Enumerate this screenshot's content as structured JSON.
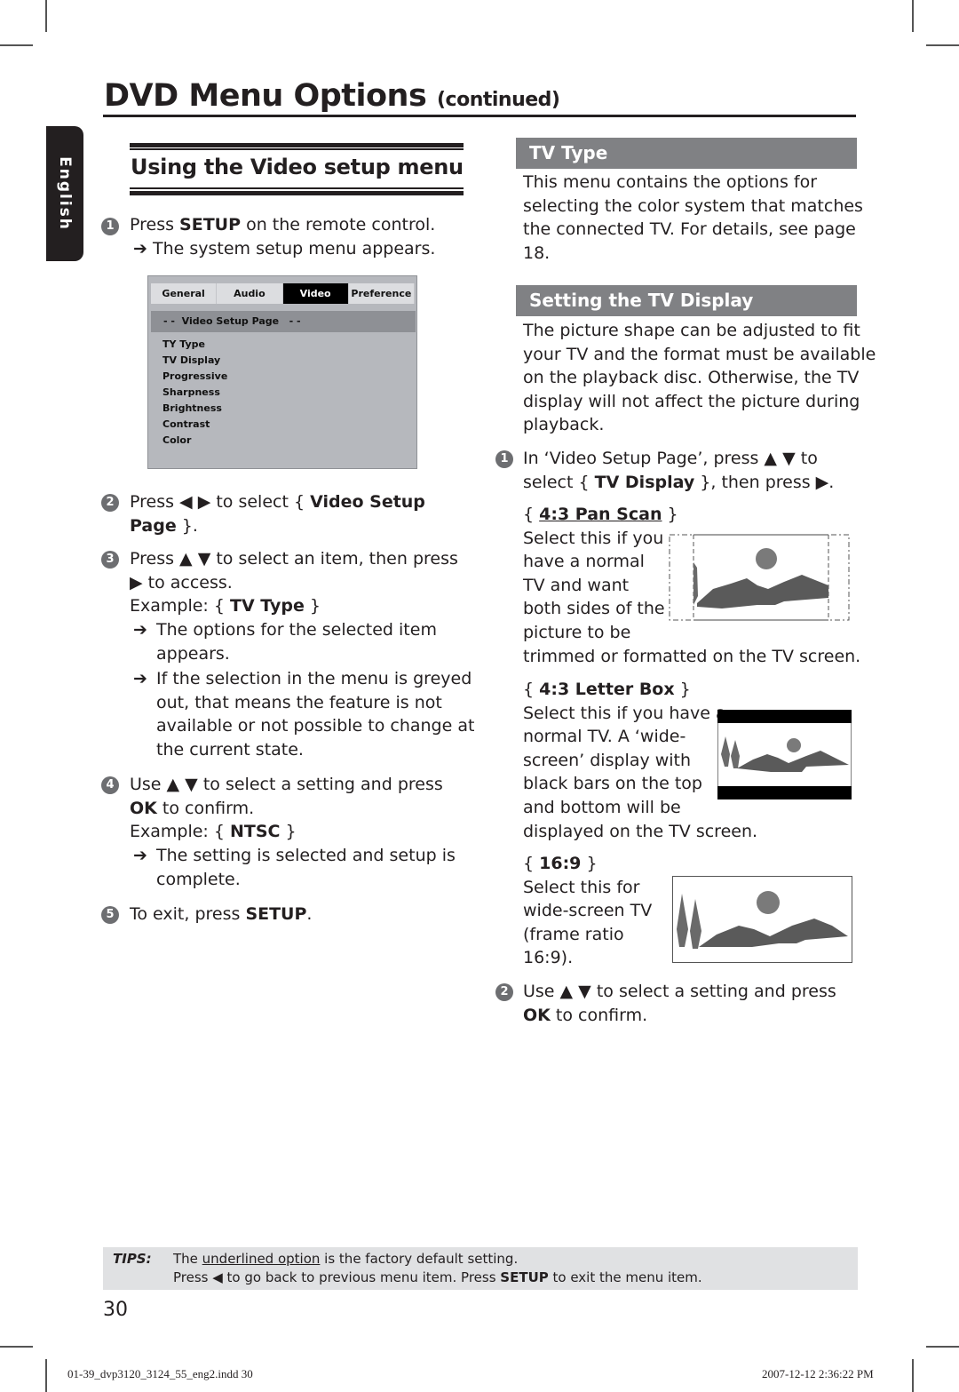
{
  "header": {
    "title": "DVD Menu Options",
    "title_suffix": "(continued)"
  },
  "language_tab": "English",
  "left": {
    "section_title": "Using the Video setup menu",
    "step1": {
      "number": "1",
      "pre": "Press ",
      "bold": "SETUP",
      "post": " on the remote control.",
      "result": "The system setup menu appears."
    },
    "setup_menu": {
      "tabs": [
        {
          "label": "General",
          "active": false
        },
        {
          "label": "Audio",
          "active": false
        },
        {
          "label": "Video",
          "active": true
        },
        {
          "label": "Preference",
          "active": false
        }
      ],
      "page_header": "- -  Video Setup Page   - -",
      "items": [
        "TY Type",
        "TV Display",
        "Progressive",
        "Sharpness",
        "Brightness",
        "Contrast",
        "Color"
      ]
    },
    "step2": {
      "number": "2",
      "pre": "Press ◀ ▶ to select { ",
      "bold1": "Video Setup",
      "bold2": "Page",
      "post": " }."
    },
    "step3": {
      "number": "3",
      "line1": "Press ▲ ▼ to select an item, then press",
      "line2": "▶ to access.",
      "example_pre": "Example: { ",
      "example_bold": "TV Type",
      "example_post": " }",
      "result1": [
        "The options for the selected item",
        "appears."
      ],
      "result2": [
        "If the selection in the menu is greyed",
        "out, that means the feature is not",
        "available or not possible to change at",
        "the current state."
      ]
    },
    "step4": {
      "number": "4",
      "line1": "Use ▲ ▼ to select a setting and press",
      "ok_bold": "OK",
      "ok_post": " to confirm.",
      "example_pre": "Example: { ",
      "example_bold": "NTSC",
      "example_post": " }",
      "result": [
        "The setting is selected and setup is",
        "complete."
      ]
    },
    "step5": {
      "number": "5",
      "pre": "To exit, press ",
      "bold": "SETUP",
      "post": "."
    }
  },
  "right": {
    "tv_type": {
      "heading": "TV Type",
      "body": [
        "This menu contains the options for",
        "selecting the color system that matches",
        "the connected TV. For details, see page",
        "18."
      ]
    },
    "tv_display": {
      "heading": "Setting the TV Display",
      "body": [
        "The picture shape can be adjusted to fit",
        "your TV and the format must be available",
        "on the playback disc. Otherwise, the TV",
        "display will not affect the picture during",
        "playback."
      ],
      "step1": {
        "number": "1",
        "line1": "In ‘Video Setup Page’, press ▲ ▼ to",
        "line2_pre": "select { ",
        "line2_bold": "TV Display",
        "line2_post": " }, then press ▶."
      },
      "options": [
        {
          "name": "4:3 Pan Scan",
          "default": true,
          "lines": [
            "Select this if you",
            "have a normal",
            "TV and want",
            "both sides of the",
            "picture to be",
            "trimmed or formatted on the TV screen."
          ],
          "illustration": "pan-scan"
        },
        {
          "name": "4:3 Letter Box",
          "default": false,
          "lines": [
            "Select this if you have a",
            "normal TV. A  ‘wide-",
            "screen’ display with",
            "black bars on the top",
            "and bottom will be",
            "displayed on the TV screen."
          ],
          "illustration": "letter-box"
        },
        {
          "name": "16:9",
          "default": false,
          "lines": [
            "Select this for",
            "wide-screen TV",
            "(frame ratio",
            "16:9)."
          ],
          "illustration": "wide-screen"
        }
      ],
      "step2": {
        "number": "2",
        "line1": "Use ▲ ▼ to select a setting and press",
        "ok_bold": "OK",
        "ok_post": " to confirm."
      }
    }
  },
  "tips": {
    "label": "TIPS:",
    "line1_pre": "The ",
    "line1_underlined": "underlined option",
    "line1_post": " is the factory default setting.",
    "line2_pre": "Press ◀ to go back to previous menu item. Press ",
    "line2_bold": "SETUP",
    "line2_post": " to exit the menu item."
  },
  "page_number": "30",
  "footer": {
    "file": "01-39_dvp3120_3124_55_eng2.indd   30",
    "timestamp": "2007-12-12   2:36:22 PM"
  }
}
